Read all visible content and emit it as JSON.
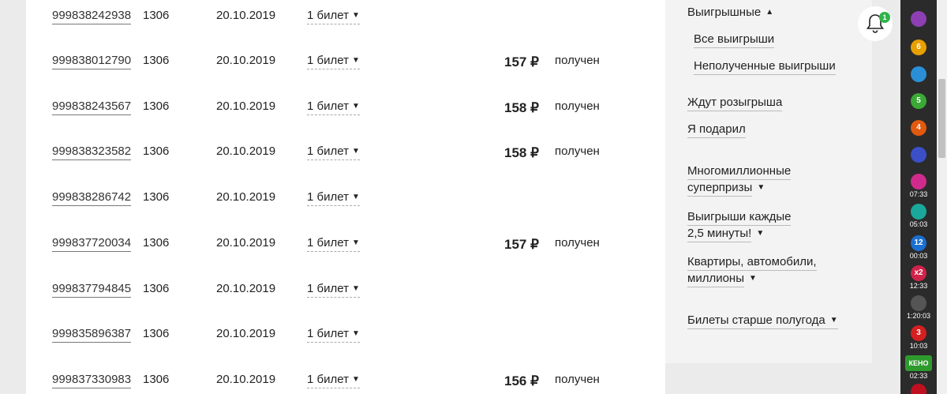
{
  "tickets": [
    {
      "number": "999838242938",
      "draw": "1306",
      "date": "20.10.2019",
      "qty": "1 билет",
      "amount": "",
      "status": ""
    },
    {
      "number": "999838012790",
      "draw": "1306",
      "date": "20.10.2019",
      "qty": "1 билет",
      "amount": "157 ₽",
      "status": "получен"
    },
    {
      "number": "999838243567",
      "draw": "1306",
      "date": "20.10.2019",
      "qty": "1 билет",
      "amount": "158 ₽",
      "status": "получен"
    },
    {
      "number": "999838323582",
      "draw": "1306",
      "date": "20.10.2019",
      "qty": "1 билет",
      "amount": "158 ₽",
      "status": "получен"
    },
    {
      "number": "999838286742",
      "draw": "1306",
      "date": "20.10.2019",
      "qty": "1 билет",
      "amount": "",
      "status": ""
    },
    {
      "number": "999837720034",
      "draw": "1306",
      "date": "20.10.2019",
      "qty": "1 билет",
      "amount": "157 ₽",
      "status": "получен"
    },
    {
      "number": "999837794845",
      "draw": "1306",
      "date": "20.10.2019",
      "qty": "1 билет",
      "amount": "",
      "status": ""
    },
    {
      "number": "999835896387",
      "draw": "1306",
      "date": "20.10.2019",
      "qty": "1 билет",
      "amount": "",
      "status": ""
    },
    {
      "number": "999837330983",
      "draw": "1306",
      "date": "20.10.2019",
      "qty": "1 билет",
      "amount": "156 ₽",
      "status": "получен"
    }
  ],
  "sidebar": {
    "winning": "Выигрышные",
    "all_wins": "Все выигрыши",
    "unclaimed_wins": "Неполученные выигрыши",
    "waiting_draw": "Ждут розыгрыша",
    "gifted": "Я подарил",
    "multimillion_1": "Многомиллионные",
    "multimillion_2": "суперпризы",
    "every_25_1": "Выигрыши каждые",
    "every_25_2": "2,5 минуты!",
    "apartments_1": "Квартиры, автомобили,",
    "apartments_2": "миллионы",
    "older": "Билеты старше полугода"
  },
  "notifications": {
    "count": "1"
  },
  "dock": [
    {
      "icon": "cube-lottery-icon",
      "time": "",
      "color": "#8e3fb4"
    },
    {
      "icon": "6-of-45-lottery-icon",
      "time": "",
      "color": "#e8a000"
    },
    {
      "icon": "ball-lottery-icon",
      "time": "",
      "color": "#2a8fd6"
    },
    {
      "icon": "5-of-36-lottery-icon",
      "time": "",
      "color": "#3aa935"
    },
    {
      "icon": "4-of-20-lottery-icon",
      "time": "",
      "color": "#e05a10"
    },
    {
      "icon": "dice-lottery-icon",
      "time": "",
      "color": "#3a4fc8"
    },
    {
      "icon": "rapido-lottery-icon",
      "time": "07:33",
      "color": "#d02b8c"
    },
    {
      "icon": "rapido2-lottery-icon",
      "time": "05:03",
      "color": "#1aa89a"
    },
    {
      "icon": "12-24-lottery-icon",
      "time": "00:03",
      "color": "#1b6fd1"
    },
    {
      "icon": "x2-lottery-icon",
      "time": "12:33",
      "color": "#d0234a"
    },
    {
      "icon": "top3-lottery-icon",
      "time": "1:20:03",
      "color": "#555555"
    },
    {
      "icon": "3-lottery-icon",
      "time": "10:03",
      "color": "#d42020"
    },
    {
      "icon": "keno-lottery-icon",
      "time": "02:33",
      "color": "#2e9a2e"
    },
    {
      "icon": "bingo-lottery-icon",
      "time": "",
      "color": "#c01020"
    }
  ],
  "icon_labels": [
    "",
    "6",
    "",
    "5",
    "4",
    "",
    "",
    "",
    "12",
    "x2",
    "",
    "3",
    "КЕНО",
    ""
  ]
}
